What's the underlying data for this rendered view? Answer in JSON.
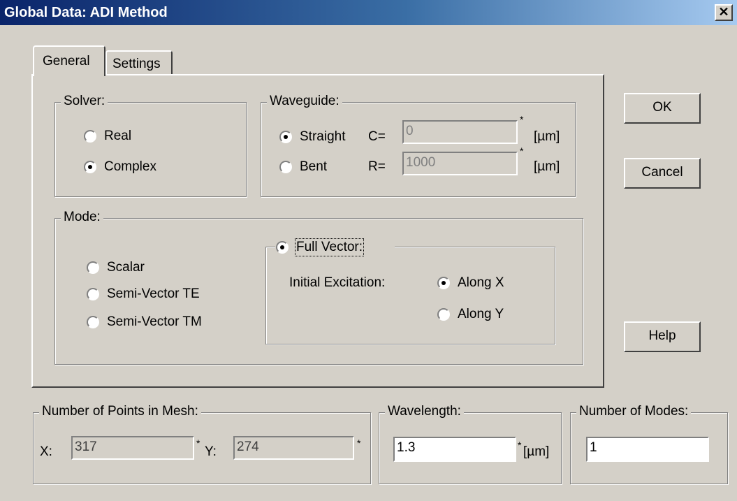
{
  "window": {
    "title": "Global Data: ADI Method",
    "close_icon": "close-icon"
  },
  "tabs": [
    {
      "label": "General",
      "selected": true
    },
    {
      "label": "Settings",
      "selected": false
    }
  ],
  "solver": {
    "legend": "Solver:",
    "options": [
      {
        "label": "Real",
        "checked": false
      },
      {
        "label": "Complex",
        "checked": true
      }
    ]
  },
  "waveguide": {
    "legend": "Waveguide:",
    "options": [
      {
        "label": "Straight",
        "checked": true
      },
      {
        "label": "Bent",
        "checked": false
      }
    ],
    "c_label": "C=",
    "c_value": "0",
    "r_label": "R=",
    "r_value": "1000",
    "star": "*",
    "unit": "[µm]"
  },
  "mode": {
    "legend": "Mode:",
    "options": [
      {
        "label": "Scalar",
        "checked": false
      },
      {
        "label": "Semi-Vector TE",
        "checked": false
      },
      {
        "label": "Semi-Vector TM",
        "checked": false
      }
    ],
    "full_vector": {
      "label": "Full Vector:",
      "checked": true,
      "initial_excitation_label": "Initial Excitation:",
      "options": [
        {
          "label": "Along X",
          "checked": true
        },
        {
          "label": "Along Y",
          "checked": false
        }
      ]
    }
  },
  "mesh": {
    "legend": "Number of Points in Mesh:",
    "x_label": "X:",
    "x_value": "317",
    "y_label": "Y:",
    "y_value": "274",
    "star": "*"
  },
  "wavelength": {
    "legend": "Wavelength:",
    "value": "1.3",
    "star": "*",
    "unit": "[µm]"
  },
  "modes": {
    "legend": "Number of Modes:",
    "value": "1"
  },
  "buttons": {
    "ok": "OK",
    "cancel": "Cancel",
    "help": "Help"
  }
}
